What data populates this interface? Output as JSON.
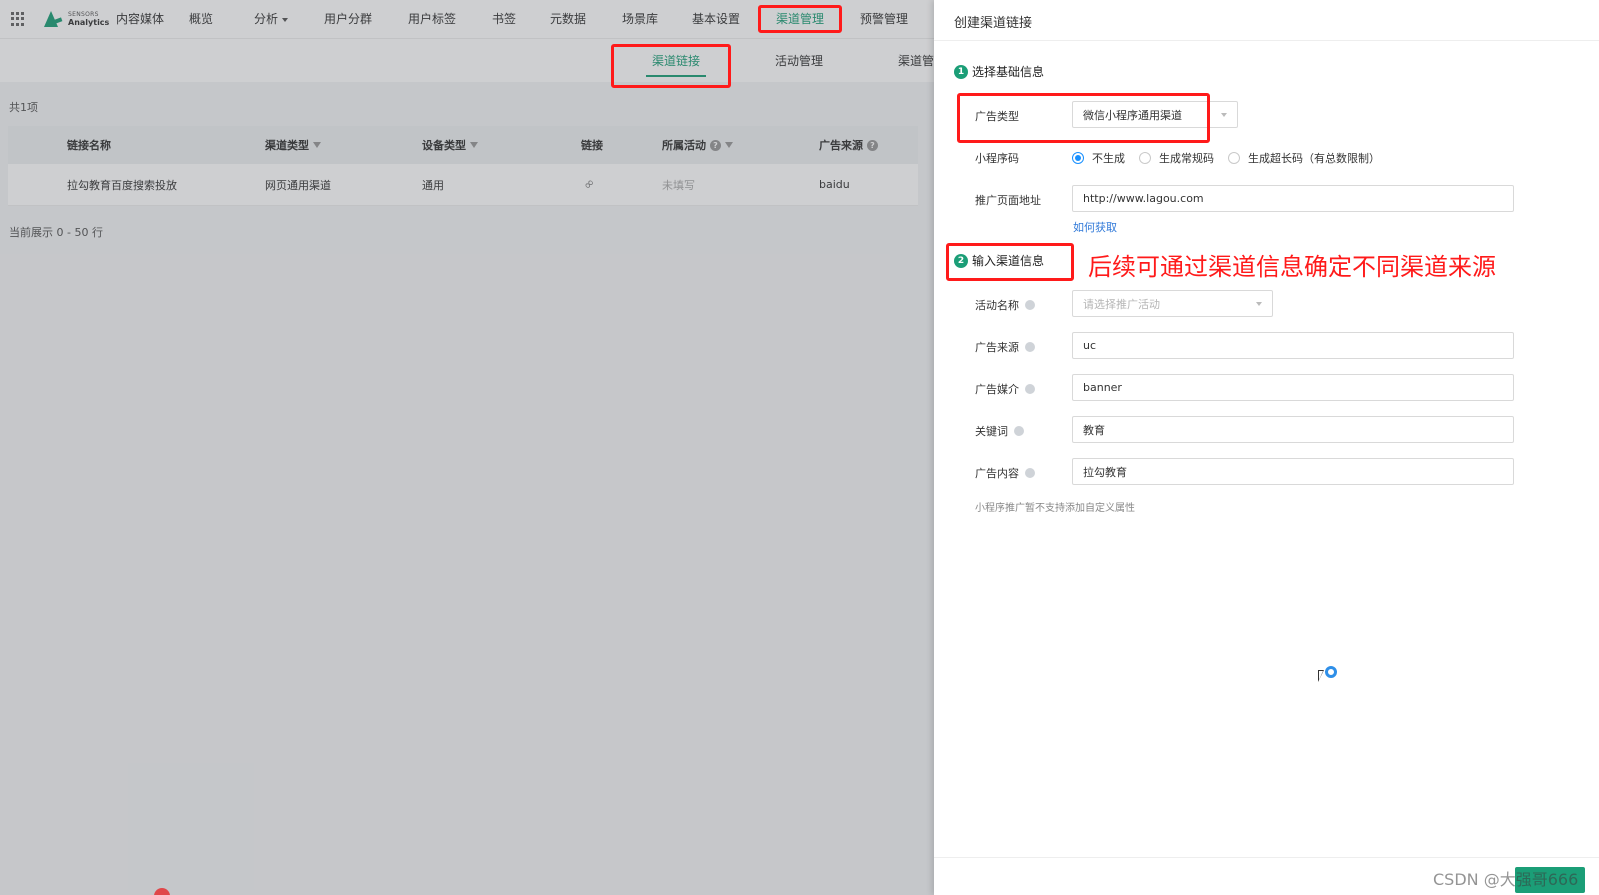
{
  "topnav": {
    "logo_line1": "SENSORS",
    "logo_line2": "Analytics",
    "items": [
      {
        "label": "内容媒体"
      },
      {
        "label": "概览"
      },
      {
        "label": "分析"
      },
      {
        "label": "用户分群"
      },
      {
        "label": "用户标签"
      },
      {
        "label": "书签"
      },
      {
        "label": "元数据"
      },
      {
        "label": "场景库"
      },
      {
        "label": "基本设置"
      },
      {
        "label": "渠道管理"
      },
      {
        "label": "预警管理"
      }
    ]
  },
  "subnav": {
    "tabs": [
      {
        "label": "渠道链接"
      },
      {
        "label": "活动管理"
      },
      {
        "label": "渠道管"
      }
    ]
  },
  "list": {
    "count_text": "共1项",
    "columns": [
      "链接名称",
      "渠道类型",
      "设备类型",
      "链接",
      "所属活动",
      "广告来源"
    ],
    "rows": [
      {
        "name": "拉勾教育百度搜索投放",
        "channel_type": "网页通用渠道",
        "device_type": "通用",
        "activity": "未填写",
        "source": "baidu"
      }
    ],
    "showing_text": "当前展示 0 - 50 行"
  },
  "drawer": {
    "title": "创建渠道链接",
    "section1": {
      "step": "1",
      "title": "选择基础信息"
    },
    "ad_type": {
      "label": "广告类型",
      "value": "微信小程序通用渠道"
    },
    "mini_code": {
      "label": "小程序码",
      "options": [
        {
          "label": "不生成",
          "checked": true
        },
        {
          "label": "生成常规码",
          "checked": false
        },
        {
          "label": "生成超长码（有总数限制）",
          "checked": false
        }
      ]
    },
    "promo_url": {
      "label": "推广页面地址",
      "value": "http://www.lagou.com",
      "help_link": "如何获取"
    },
    "section2": {
      "step": "2",
      "title": "输入渠道信息"
    },
    "activity": {
      "label": "活动名称",
      "placeholder": "请选择推广活动"
    },
    "ad_source": {
      "label": "广告来源",
      "value": "uc"
    },
    "ad_medium": {
      "label": "广告媒介",
      "value": "banner"
    },
    "keyword": {
      "label": "关键词",
      "value": "教育"
    },
    "ad_content": {
      "label": "广告内容",
      "value": "拉勾教育"
    },
    "hint": "小程序推广暂不支持添加自定义属性",
    "footer_watermark": "CSDN @大强哥666"
  },
  "annotation": {
    "text": "后续可通过渠道信息确定不同渠道来源",
    "color": "#ff1a1a"
  },
  "colors": {
    "accent": "#1b9e77",
    "link": "#2f78d8",
    "radio": "#1890ff"
  }
}
